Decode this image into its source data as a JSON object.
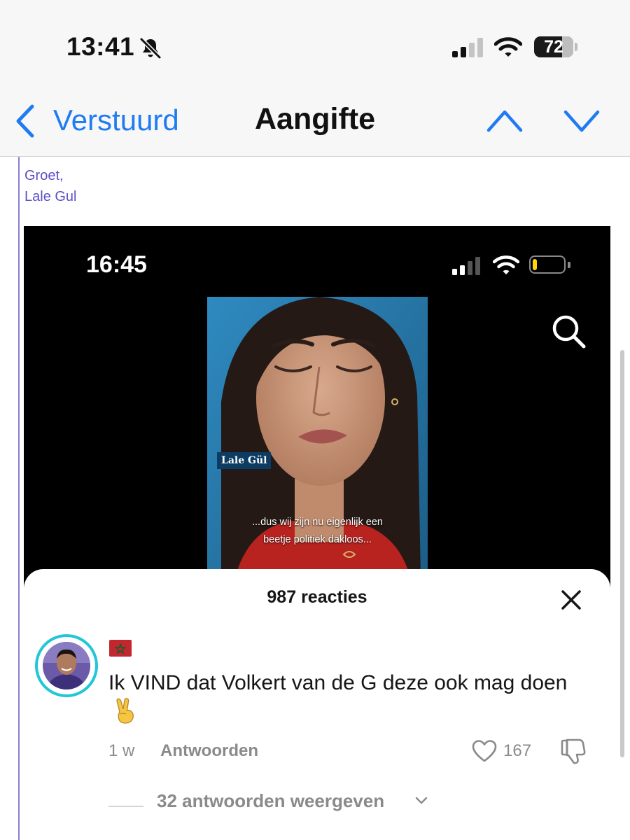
{
  "status_bar": {
    "time": "13:41",
    "silent_icon": "bell-slash-icon",
    "signal_bars_active": 2,
    "battery_percent": "72",
    "battery_level": 0.72
  },
  "nav": {
    "back_label": "Verstuurd",
    "title": "Aangifte",
    "up_icon": "chevron-up-icon",
    "down_icon": "chevron-down-icon",
    "accent_color": "#1f7bf2"
  },
  "email": {
    "signature_lines": [
      "Groet,",
      "Lale Gul"
    ],
    "quote_color": "#5b4fc7"
  },
  "embedded_screenshot": {
    "status_bar": {
      "time": "16:45",
      "battery_level": 0.25,
      "battery_color": "#ffd60a"
    },
    "video": {
      "name_tag": "Lale Gül",
      "caption_line1": "...dus wij zijn nu eigenlijk een",
      "caption_line2": "beetje politiek dakloos..."
    },
    "comments": {
      "title": "987 reacties",
      "close_icon": "close-icon",
      "comment": {
        "flag_icon": "morocco-flag-icon",
        "text": "Ik VIND dat Volkert van de G deze ook mag doen",
        "emoji_icon": "victory-hand-icon",
        "age": "1 w",
        "reply_label": "Antwoorden",
        "like_count": "167",
        "replies_label": "32 antwoorden weergeven"
      },
      "ring_color": "#21c6d8"
    }
  }
}
